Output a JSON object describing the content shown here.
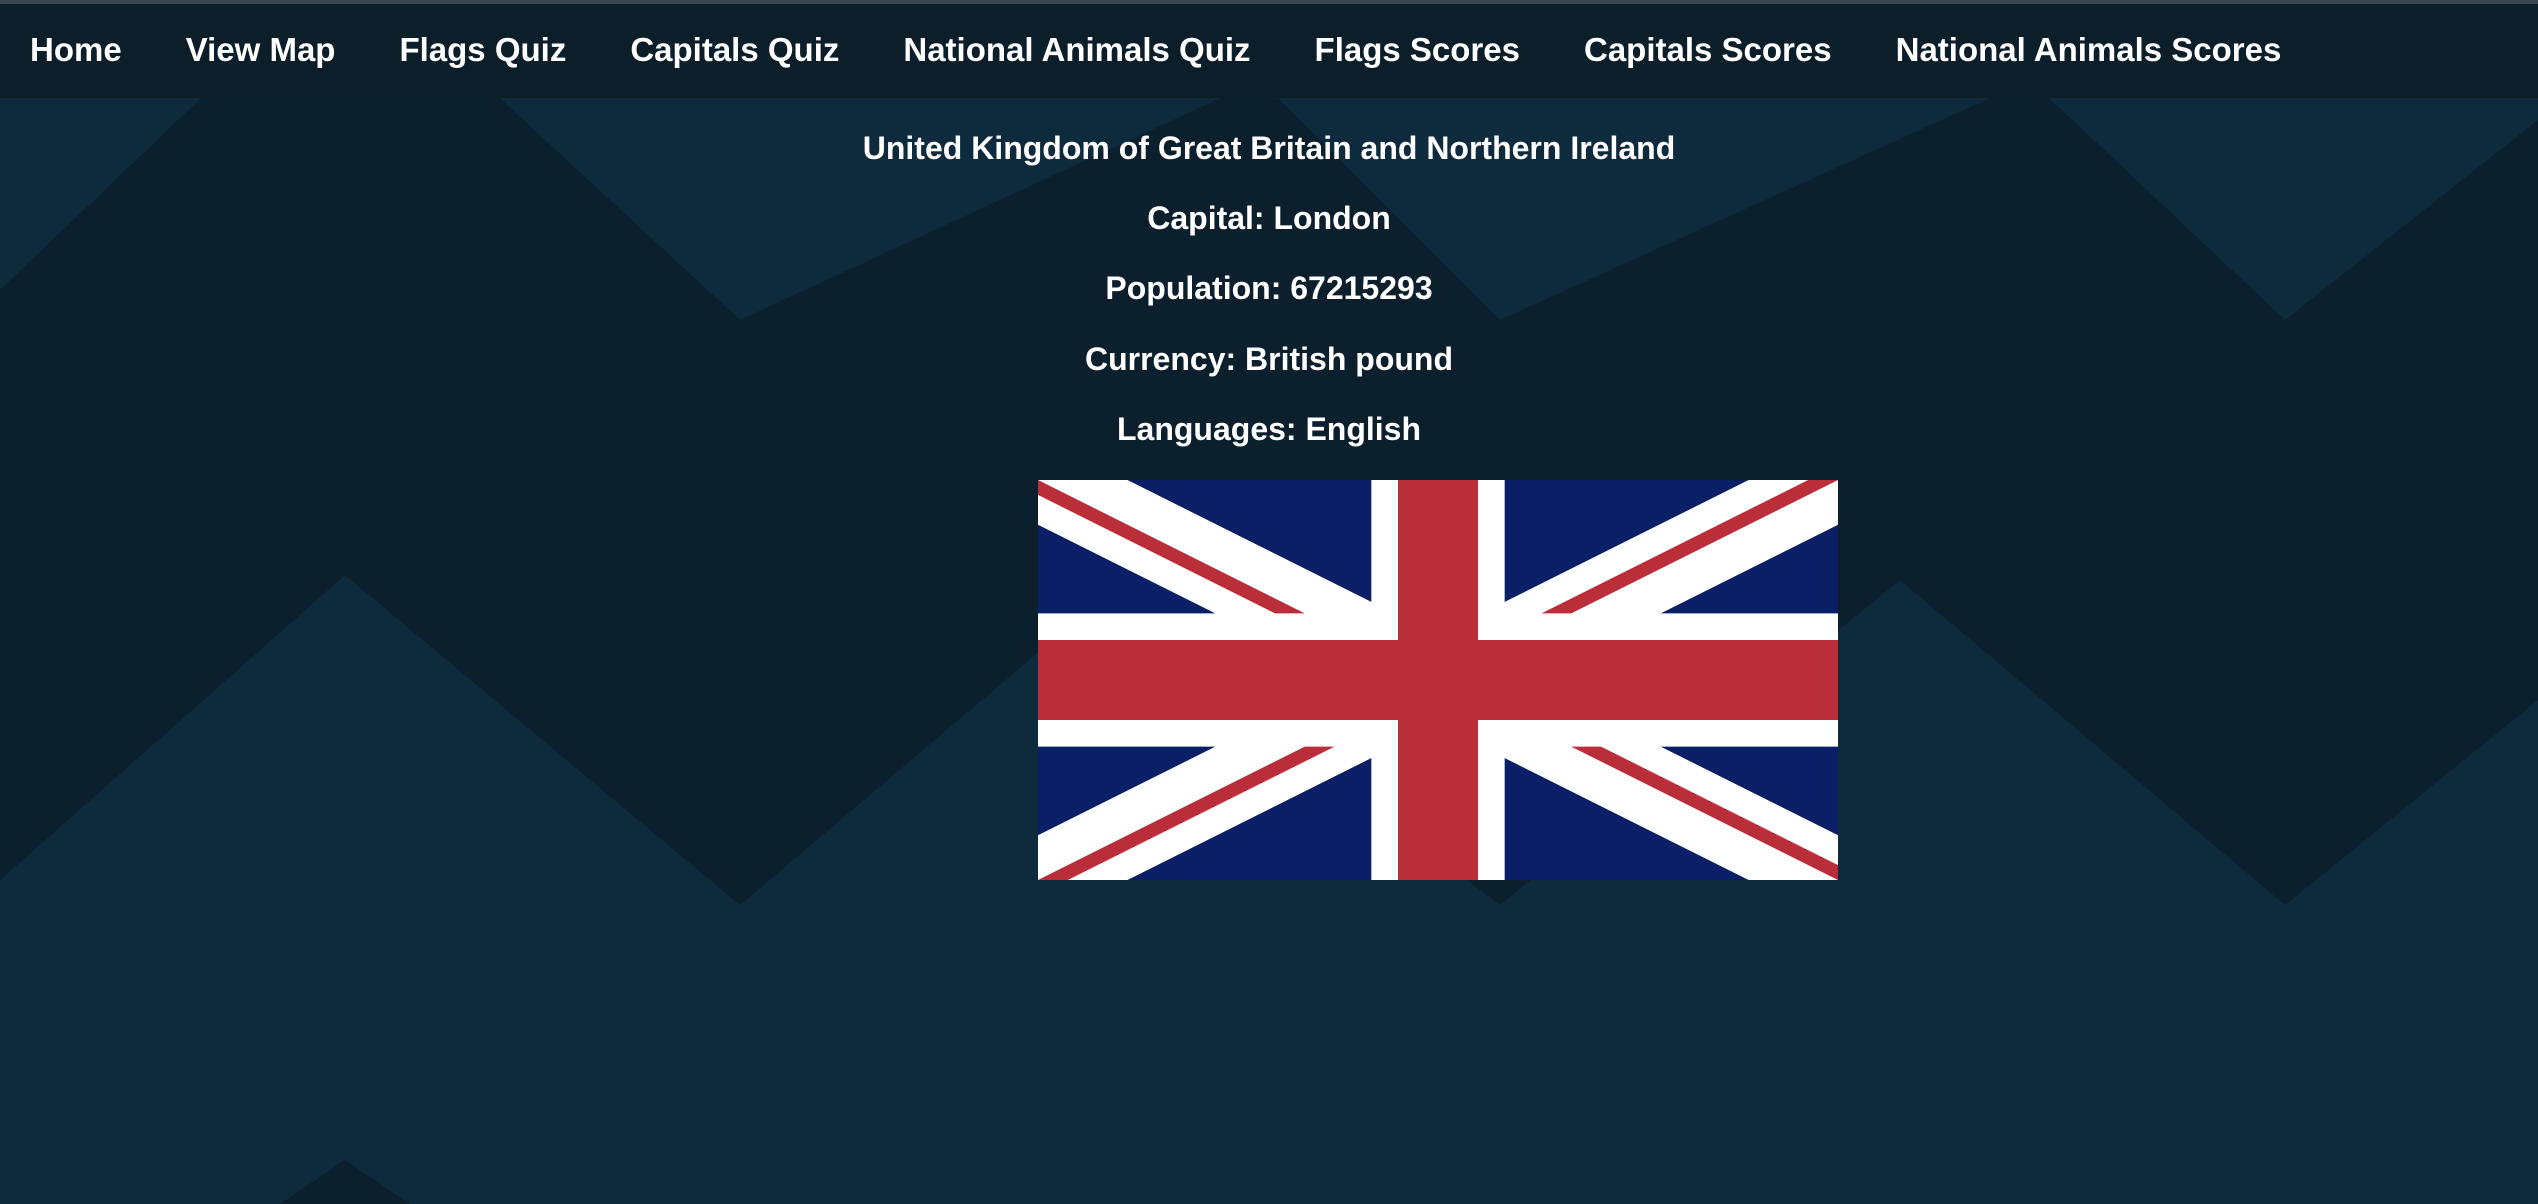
{
  "nav": {
    "items": [
      {
        "label": "Home"
      },
      {
        "label": "View Map"
      },
      {
        "label": "Flags Quiz"
      },
      {
        "label": "Capitals Quiz"
      },
      {
        "label": "National Animals Quiz"
      },
      {
        "label": "Flags Scores"
      },
      {
        "label": "Capitals Scores"
      },
      {
        "label": "National Animals Scores"
      }
    ]
  },
  "country": {
    "name": "United Kingdom of Great Britain and Northern Ireland",
    "capital": "Capital: London",
    "population": "Population: 67215293",
    "currency": "Currency: British pound",
    "languages": "Languages: English",
    "flag": {
      "icon": "union-jack-flag",
      "colors": {
        "blue": "#0b1f66",
        "red": "#b92e38",
        "white": "#ffffff"
      }
    }
  },
  "theme": {
    "background": "#0b1f2d",
    "navbar": "#0c1e2a",
    "pattern_light": "#0e2a3d",
    "text": "#ffffff"
  }
}
